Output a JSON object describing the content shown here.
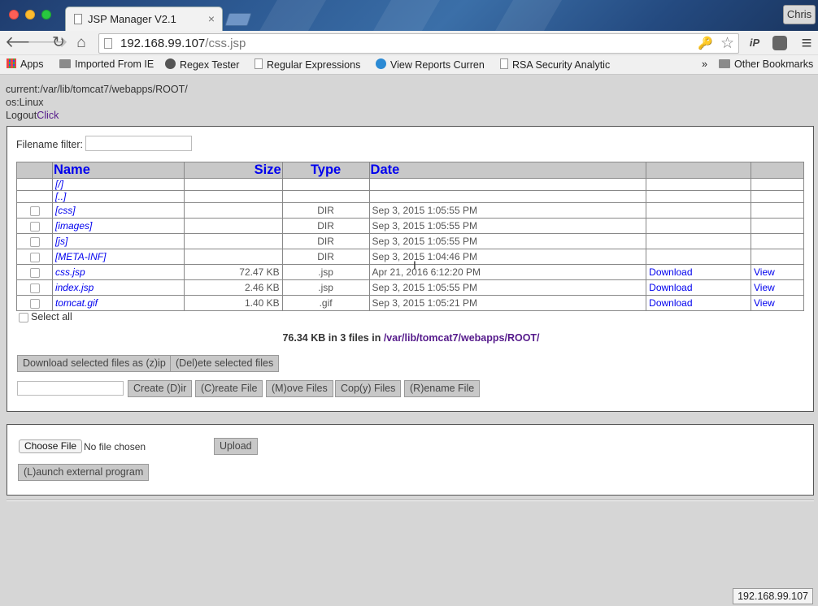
{
  "browser": {
    "tab_title": "JSP Manager V2.1",
    "tab_close": "×",
    "user_button": "Chris",
    "url_host": "192.168.99.107",
    "url_path": "/css.jsp",
    "back": "🡐",
    "forward": "🡒",
    "reload": "↻",
    "home": "⌂",
    "key": "🔑",
    "star": "☆",
    "ext_ip": "iP",
    "menu": "≡",
    "bookmarks": [
      {
        "label": "Apps",
        "icon": "apps-icon"
      },
      {
        "label": "Imported From IE",
        "icon": "folder-icon"
      },
      {
        "label": "Regex Tester",
        "icon": "regex-icon"
      },
      {
        "label": "Regular Expressions",
        "icon": "page-icon"
      },
      {
        "label": "View Reports Curren",
        "icon": "reports-icon"
      },
      {
        "label": "RSA Security Analytic",
        "icon": "page-icon"
      }
    ],
    "bookmarks_more": "»",
    "other_bookmarks": "Other Bookmarks",
    "status_url": "192.168.99.107"
  },
  "info": {
    "current": "current:/var/lib/tomcat7/webapps/ROOT/",
    "os": "os:Linux",
    "logout_prefix": "Logout",
    "logout_link": "Click"
  },
  "filter": {
    "label": "Filename filter:",
    "value": ""
  },
  "table": {
    "headers": {
      "name": "Name",
      "size": "Size",
      "type": "Type",
      "date": "Date"
    },
    "rows": [
      {
        "name": "[/]",
        "size": "",
        "type": "",
        "date": "",
        "download": "",
        "view": "",
        "checkbox": false
      },
      {
        "name": "[..]",
        "size": "",
        "type": "",
        "date": "",
        "download": "",
        "view": "",
        "checkbox": false
      },
      {
        "name": "[css]",
        "size": "",
        "type": "DIR",
        "date": "Sep 3, 2015 1:05:55 PM",
        "download": "",
        "view": "",
        "checkbox": true
      },
      {
        "name": "[images]",
        "size": "",
        "type": "DIR",
        "date": "Sep 3, 2015 1:05:55 PM",
        "download": "",
        "view": "",
        "checkbox": true
      },
      {
        "name": "[js]",
        "size": "",
        "type": "DIR",
        "date": "Sep 3, 2015 1:05:55 PM",
        "download": "",
        "view": "",
        "checkbox": true
      },
      {
        "name": "[META-INF]",
        "size": "",
        "type": "DIR",
        "date": "Sep 3, 2015 1:04:46 PM",
        "download": "",
        "view": "",
        "checkbox": true
      },
      {
        "name": "css.jsp",
        "size": "72.47 KB",
        "type": ".jsp",
        "date": "Apr 21, 2016 6:12:20 PM",
        "download": "Download",
        "view": "View",
        "checkbox": true
      },
      {
        "name": "index.jsp",
        "size": "2.46 KB",
        "type": ".jsp",
        "date": "Sep 3, 2015 1:05:55 PM",
        "download": "Download",
        "view": "View",
        "checkbox": true
      },
      {
        "name": "tomcat.gif",
        "size": "1.40 KB",
        "type": ".gif",
        "date": "Sep 3, 2015 1:05:21 PM",
        "download": "Download",
        "view": "View",
        "checkbox": true
      }
    ]
  },
  "select_all": "Select all",
  "summary": {
    "text": "76.34 KB in 3 files in ",
    "path": "/var/lib/tomcat7/webapps/ROOT/"
  },
  "actions": {
    "download_zip": "Download selected files as (z)ip",
    "delete": "(Del)ete selected files",
    "create_dir": "Create (D)ir",
    "create_file": "(C)reate File",
    "move": "(M)ove Files",
    "copy": "Cop(y) Files",
    "rename": "(R)ename File",
    "name_value": ""
  },
  "upload": {
    "choose_file": "Choose File",
    "no_file": "No file chosen",
    "upload": "Upload",
    "launch": "(L)aunch external program"
  }
}
